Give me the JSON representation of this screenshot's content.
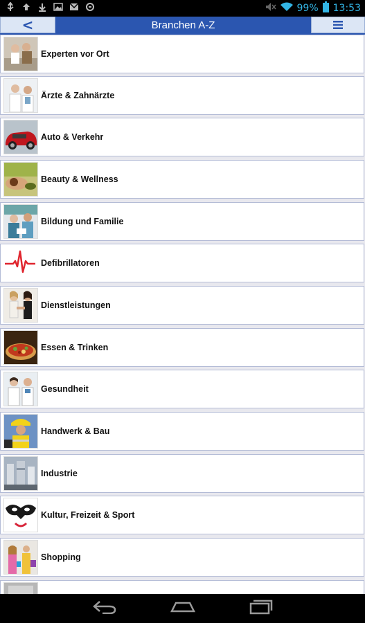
{
  "statusbar": {
    "battery": "99%",
    "time": "13:53"
  },
  "titlebar": {
    "back_label": "<",
    "title": "Branchen A-Z"
  },
  "categories": [
    {
      "label": "Experten vor Ort",
      "icon": "experts-photo-icon"
    },
    {
      "label": "Ärzte & Zahnärzte",
      "icon": "doctors-photo-icon"
    },
    {
      "label": "Auto & Verkehr",
      "icon": "car-photo-icon"
    },
    {
      "label": "Beauty & Wellness",
      "icon": "wellness-photo-icon"
    },
    {
      "label": "Bildung und Familie",
      "icon": "education-photo-icon"
    },
    {
      "label": "Defibrillatoren",
      "icon": "heartbeat-icon"
    },
    {
      "label": "Dienstleistungen",
      "icon": "services-photo-icon"
    },
    {
      "label": "Essen & Trinken",
      "icon": "pizza-photo-icon"
    },
    {
      "label": "Gesundheit",
      "icon": "health-photo-icon"
    },
    {
      "label": "Handwerk & Bau",
      "icon": "construction-photo-icon"
    },
    {
      "label": "Industrie",
      "icon": "industry-photo-icon"
    },
    {
      "label": "Kultur, Freizeit & Sport",
      "icon": "mask-photo-icon"
    },
    {
      "label": "Shopping",
      "icon": "shopping-photo-icon"
    },
    {
      "label": "",
      "icon": "partial-photo-icon"
    }
  ],
  "colors": {
    "header_blue": "#2b56b0",
    "status_accent": "#33b5e5"
  }
}
